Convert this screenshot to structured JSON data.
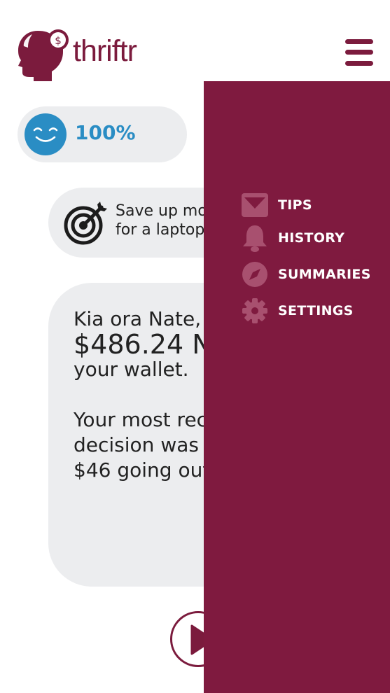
{
  "brand": {
    "name": "thriftr",
    "logo_symbol": "$"
  },
  "header": {
    "menu_icon": "hamburger-icon"
  },
  "mood": {
    "percent": "100%",
    "icon": "smiley-face-icon",
    "color": "#2a8dc4"
  },
  "goal": {
    "line1": "Save up mo",
    "line2": "for a laptop",
    "icon": "target-icon"
  },
  "message": {
    "greeting": "Kia ora Nate,",
    "amount": "$486.24 N",
    "line3": "your wallet.",
    "line4": "Your most rec",
    "line5": "decision was",
    "line6": "$46 going out"
  },
  "player": {
    "icon": "play-icon"
  },
  "drawer": {
    "background": "#7f1a3f",
    "items": [
      {
        "label": "TIPS",
        "icon": "envelope-icon"
      },
      {
        "label": "HISTORY",
        "icon": "bell-icon"
      },
      {
        "label": "SUMMARIES",
        "icon": "compass-icon"
      },
      {
        "label": "SETTINGS",
        "icon": "gear-icon"
      }
    ]
  },
  "colors": {
    "brand": "#7b1b3d",
    "card": "#ecedef",
    "accent": "#2a8dc4"
  }
}
